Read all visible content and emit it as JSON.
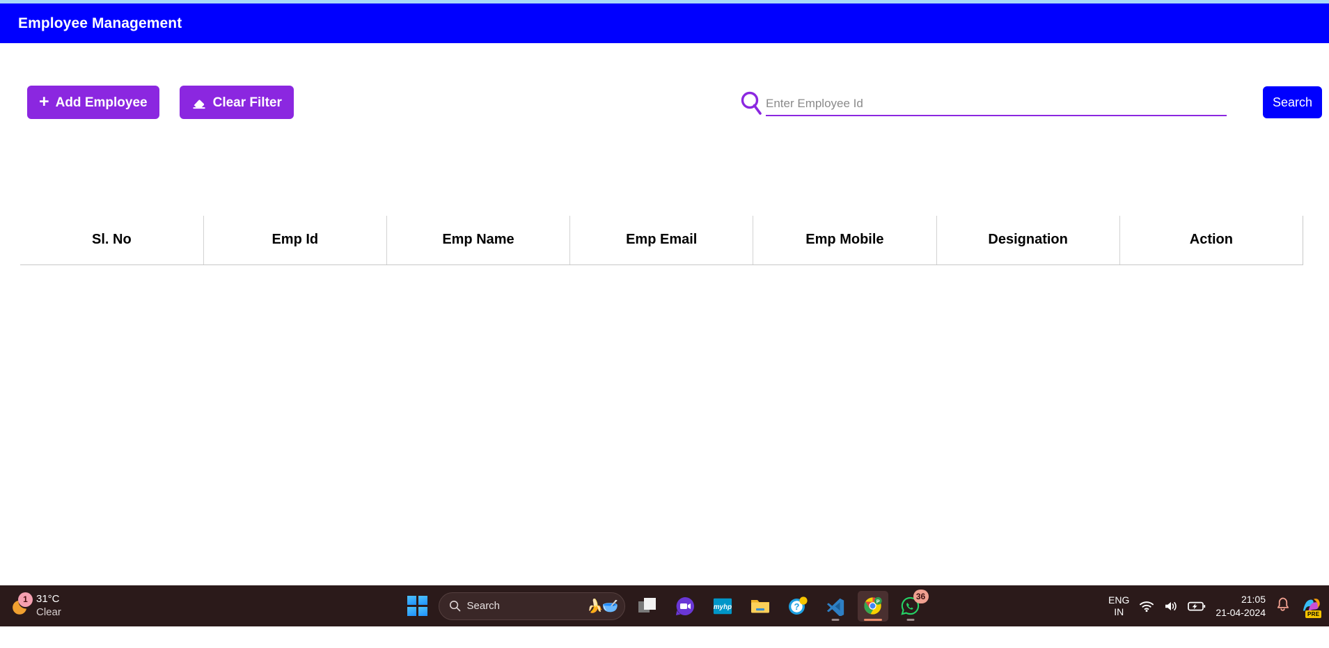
{
  "app": {
    "header_title": "Employee Management",
    "header_bg": "#0000FF"
  },
  "toolbar": {
    "add_employee_label": "Add Employee",
    "add_employee_icon": "plus-icon",
    "clear_filter_label": "Clear Filter",
    "clear_filter_icon": "eraser-icon",
    "button_color": "#8B27E0"
  },
  "search": {
    "icon": "magnifier-icon",
    "placeholder": "Enter Employee Id",
    "value": "",
    "button_label": "Search",
    "button_color": "#0000FF",
    "underline_color": "#8B27E0"
  },
  "table": {
    "columns": [
      "Sl. No",
      "Emp Id",
      "Emp Name",
      "Emp Email",
      "Emp Mobile",
      "Designation",
      "Action"
    ],
    "rows": []
  },
  "taskbar": {
    "weather": {
      "badge": "1",
      "temperature": "31°C",
      "condition": "Clear",
      "icon": "crescent-moon-icon"
    },
    "start_label": "Start",
    "search": {
      "placeholder": "Search",
      "icon": "search-icon",
      "emoji": "🍌🥣"
    },
    "apps": [
      {
        "name": "task-view",
        "label": "Task View",
        "badge": "",
        "running": false
      },
      {
        "name": "chat",
        "label": "Chat",
        "badge": "",
        "running": false
      },
      {
        "name": "myhp",
        "label": "myHP",
        "badge": "",
        "running": false
      },
      {
        "name": "file-explorer",
        "label": "File Explorer",
        "badge": "",
        "running": false
      },
      {
        "name": "help",
        "label": "Get Help",
        "badge": "",
        "running": false
      },
      {
        "name": "vscode",
        "label": "Visual Studio Code",
        "badge": "",
        "running": true
      },
      {
        "name": "chrome",
        "label": "Google Chrome",
        "badge": "P",
        "running": true
      },
      {
        "name": "whatsapp",
        "label": "WhatsApp",
        "badge": "36",
        "running": true
      }
    ],
    "tray": {
      "language_line1": "ENG",
      "language_line2": "IN",
      "wifi_icon": "wifi-icon",
      "volume_icon": "speaker-icon",
      "battery_icon": "battery-charging-icon",
      "time": "21:05",
      "date": "21-04-2024",
      "notification_icon": "bell-icon",
      "copilot_badge": "PRE"
    }
  }
}
